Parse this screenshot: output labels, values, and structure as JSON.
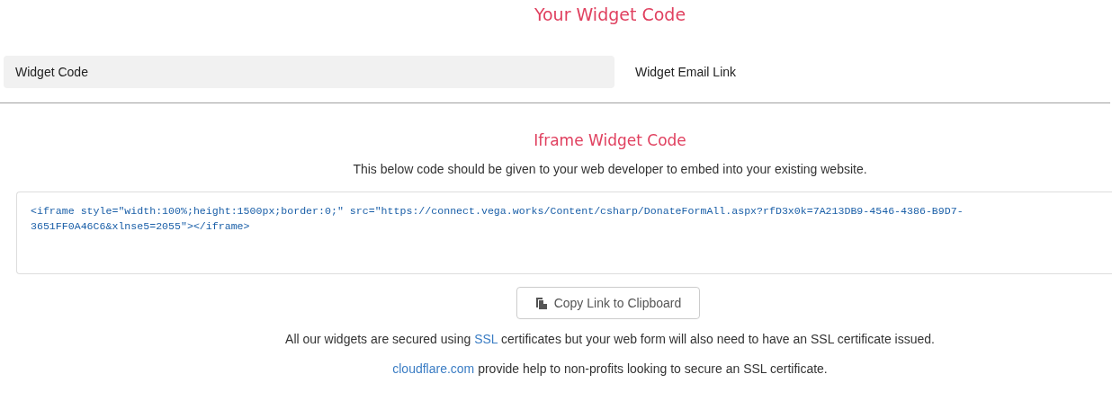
{
  "title": "Your Widget Code",
  "tabs": [
    {
      "label": "Widget Code",
      "selected": true
    },
    {
      "label": "Widget Email Link",
      "selected": false
    }
  ],
  "section": {
    "title": "Iframe Widget Code",
    "description": "This below code should be given to your web developer to embed into your existing website.",
    "code": "<iframe style=\"width:100%;height:1500px;border:0;\" src=\"https://connect.vega.works/Content/csharp/DonateFormAll.aspx?rfD3x0k=7A213DB9-4546-4386-B9D7-3651FF0A46C6&xlnse5=2055\"></iframe>",
    "copy_button": "Copy Link to Clipboard"
  },
  "notes": [
    [
      {
        "text": "All our widgets are secured using ",
        "kind": "text"
      },
      {
        "text": "SSL",
        "kind": "link"
      },
      {
        "text": " certificates but your web form will also need to have an SSL certificate issued.",
        "kind": "text"
      }
    ],
    [
      {
        "text": "cloudflare.com",
        "kind": "link"
      },
      {
        "text": " provide help to non-profits looking to secure an SSL certificate.",
        "kind": "text"
      }
    ]
  ]
}
